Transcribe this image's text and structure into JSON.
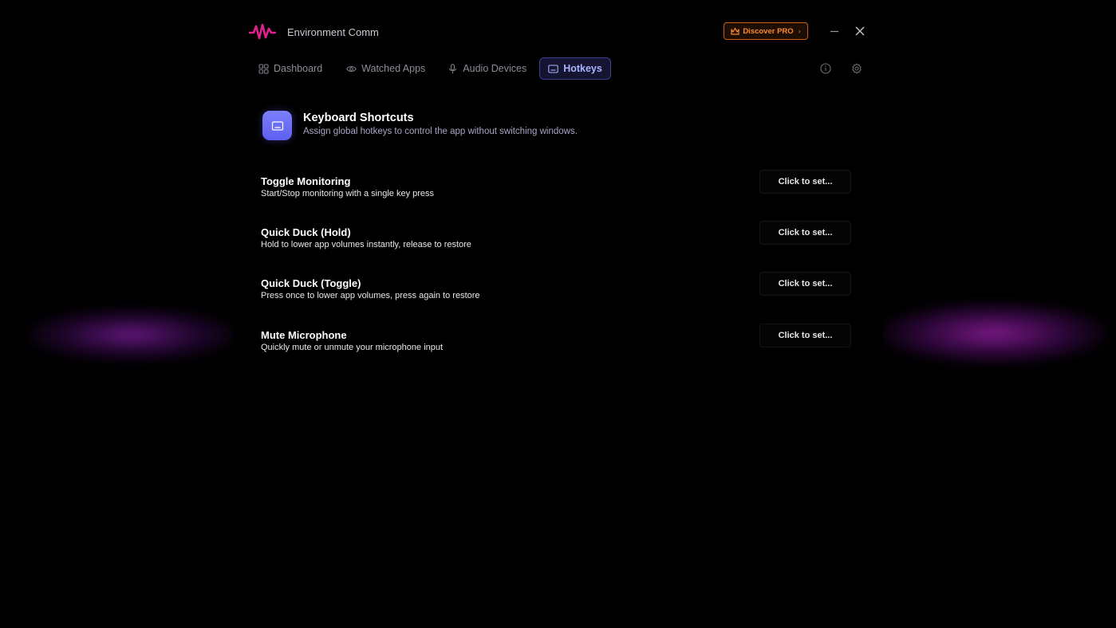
{
  "app": {
    "title": "Environment Comm",
    "pro_label": "Discover PRO",
    "pro_chevron": "›"
  },
  "nav": {
    "tabs": [
      {
        "label": "Dashboard",
        "icon": "grid-icon",
        "active": false
      },
      {
        "label": "Watched Apps",
        "icon": "eye-icon",
        "active": false
      },
      {
        "label": "Audio Devices",
        "icon": "microphone-icon",
        "active": false
      },
      {
        "label": "Hotkeys",
        "icon": "keyboard-icon",
        "active": true
      }
    ]
  },
  "section": {
    "title": "Keyboard Shortcuts",
    "subtitle": "Assign global hotkeys to control the app without switching windows."
  },
  "hotkeys": [
    {
      "title": "Toggle Monitoring",
      "desc": "Start/Stop monitoring with a single key press",
      "button": "Click to set..."
    },
    {
      "title": "Quick Duck (Hold)",
      "desc": "Hold to lower app volumes instantly, release to restore",
      "button": "Click to set..."
    },
    {
      "title": "Quick Duck (Toggle)",
      "desc": "Press once to lower app volumes, press again to restore",
      "button": "Click to set..."
    },
    {
      "title": "Mute Microphone",
      "desc": "Quickly mute or unmute your microphone input",
      "button": "Click to set..."
    }
  ],
  "colors": {
    "accent": "#6b6ff8",
    "pro_orange": "#ff8a2a",
    "logo_magenta": "#e0208c"
  }
}
